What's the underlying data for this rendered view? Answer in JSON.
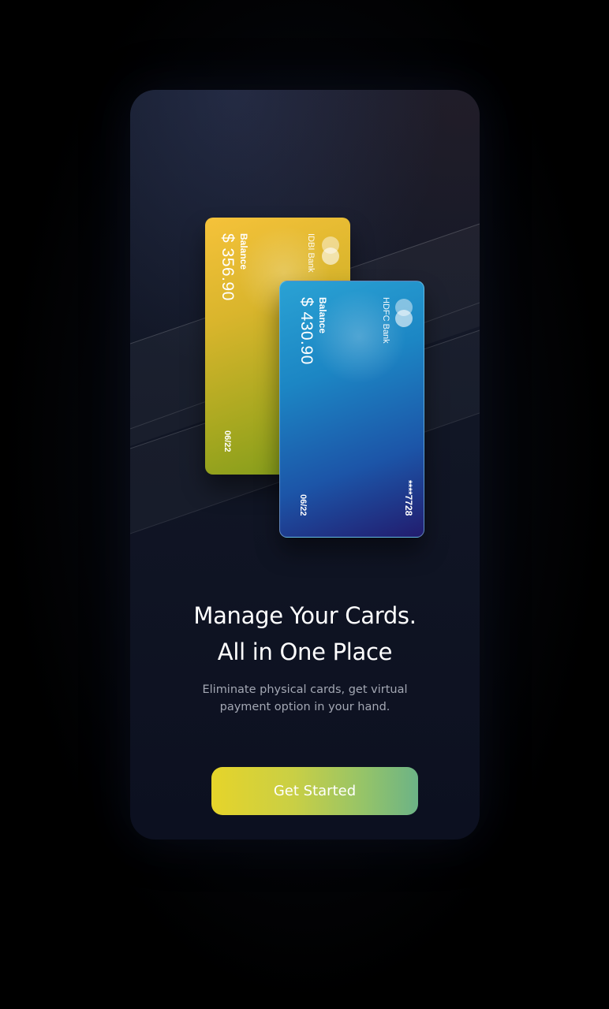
{
  "cards": [
    {
      "bank": "IDBI Bank",
      "balance_label": "Balance",
      "balance": "$ 356.90",
      "expiry": "06/22",
      "icon": "card-network-icon"
    },
    {
      "bank": "HDFC Bank",
      "balance_label": "Balance",
      "balance": "$ 430.90",
      "expiry": "06/22",
      "number": "****7728",
      "icon": "card-network-icon"
    }
  ],
  "headline": {
    "line1": "Manage Your Cards.",
    "line2": "All in One Place"
  },
  "subtitle": {
    "line1": "Eliminate physical cards, get virtual",
    "line2": "payment option in your hand."
  },
  "cta": {
    "label": "Get Started"
  },
  "colors": {
    "background": "#000000",
    "panel": "#121727",
    "gold_card": "#d9b52c",
    "blue_card": "#1c6fb8",
    "cta_start": "#e6d42a",
    "cta_end": "#6cb386"
  }
}
